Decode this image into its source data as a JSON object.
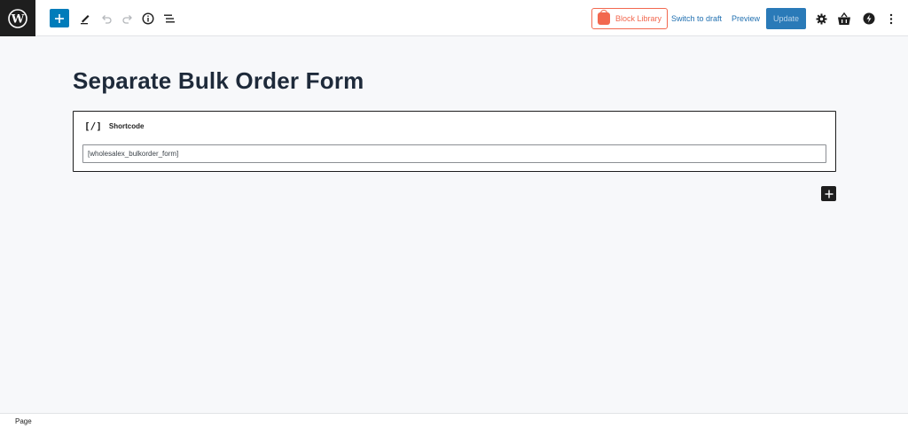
{
  "toolbar": {
    "wp_logo_icon": "wordpress-icon",
    "add_icon": "plus-icon",
    "tools_icon": "pencil-icon",
    "undo_icon": "undo-icon",
    "redo_icon": "redo-icon",
    "info_icon": "info-icon",
    "list_view_icon": "list-view-icon",
    "block_library_label": "Block Library",
    "switch_to_draft_label": "Switch to draft",
    "preview_label": "Preview",
    "update_label": "Update",
    "settings_icon": "gear-icon",
    "shop_icon": "shopping-basket-icon",
    "plugin_icon": "plugin-logo-icon",
    "more_icon": "more-vertical-icon"
  },
  "editor": {
    "page_title": "Separate Bulk Order Form",
    "shortcode_block": {
      "icon_text": "[/]",
      "label": "Shortcode",
      "value": "[wholesalex_bulkorder_form]"
    }
  },
  "footer": {
    "breadcrumb_label": "Page"
  },
  "colors": {
    "accent": "#007cba",
    "block_library": "#f2684f",
    "link": "#2271b1",
    "update_bg": "#2a7ab8",
    "dark": "#1e1e1e"
  }
}
